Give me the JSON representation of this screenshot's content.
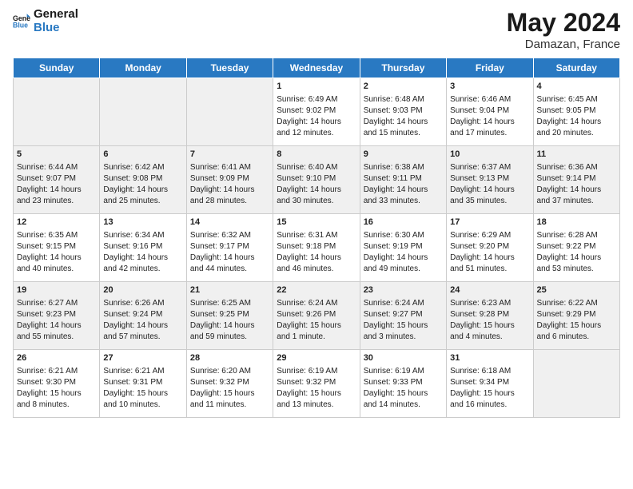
{
  "logo": {
    "line1": "General",
    "line2": "Blue"
  },
  "title": "May 2024",
  "location": "Damazan, France",
  "days_header": [
    "Sunday",
    "Monday",
    "Tuesday",
    "Wednesday",
    "Thursday",
    "Friday",
    "Saturday"
  ],
  "weeks": [
    [
      {
        "day": "",
        "content": ""
      },
      {
        "day": "",
        "content": ""
      },
      {
        "day": "",
        "content": ""
      },
      {
        "day": "1",
        "content": "Sunrise: 6:49 AM\nSunset: 9:02 PM\nDaylight: 14 hours\nand 12 minutes."
      },
      {
        "day": "2",
        "content": "Sunrise: 6:48 AM\nSunset: 9:03 PM\nDaylight: 14 hours\nand 15 minutes."
      },
      {
        "day": "3",
        "content": "Sunrise: 6:46 AM\nSunset: 9:04 PM\nDaylight: 14 hours\nand 17 minutes."
      },
      {
        "day": "4",
        "content": "Sunrise: 6:45 AM\nSunset: 9:05 PM\nDaylight: 14 hours\nand 20 minutes."
      }
    ],
    [
      {
        "day": "5",
        "content": "Sunrise: 6:44 AM\nSunset: 9:07 PM\nDaylight: 14 hours\nand 23 minutes."
      },
      {
        "day": "6",
        "content": "Sunrise: 6:42 AM\nSunset: 9:08 PM\nDaylight: 14 hours\nand 25 minutes."
      },
      {
        "day": "7",
        "content": "Sunrise: 6:41 AM\nSunset: 9:09 PM\nDaylight: 14 hours\nand 28 minutes."
      },
      {
        "day": "8",
        "content": "Sunrise: 6:40 AM\nSunset: 9:10 PM\nDaylight: 14 hours\nand 30 minutes."
      },
      {
        "day": "9",
        "content": "Sunrise: 6:38 AM\nSunset: 9:11 PM\nDaylight: 14 hours\nand 33 minutes."
      },
      {
        "day": "10",
        "content": "Sunrise: 6:37 AM\nSunset: 9:13 PM\nDaylight: 14 hours\nand 35 minutes."
      },
      {
        "day": "11",
        "content": "Sunrise: 6:36 AM\nSunset: 9:14 PM\nDaylight: 14 hours\nand 37 minutes."
      }
    ],
    [
      {
        "day": "12",
        "content": "Sunrise: 6:35 AM\nSunset: 9:15 PM\nDaylight: 14 hours\nand 40 minutes."
      },
      {
        "day": "13",
        "content": "Sunrise: 6:34 AM\nSunset: 9:16 PM\nDaylight: 14 hours\nand 42 minutes."
      },
      {
        "day": "14",
        "content": "Sunrise: 6:32 AM\nSunset: 9:17 PM\nDaylight: 14 hours\nand 44 minutes."
      },
      {
        "day": "15",
        "content": "Sunrise: 6:31 AM\nSunset: 9:18 PM\nDaylight: 14 hours\nand 46 minutes."
      },
      {
        "day": "16",
        "content": "Sunrise: 6:30 AM\nSunset: 9:19 PM\nDaylight: 14 hours\nand 49 minutes."
      },
      {
        "day": "17",
        "content": "Sunrise: 6:29 AM\nSunset: 9:20 PM\nDaylight: 14 hours\nand 51 minutes."
      },
      {
        "day": "18",
        "content": "Sunrise: 6:28 AM\nSunset: 9:22 PM\nDaylight: 14 hours\nand 53 minutes."
      }
    ],
    [
      {
        "day": "19",
        "content": "Sunrise: 6:27 AM\nSunset: 9:23 PM\nDaylight: 14 hours\nand 55 minutes."
      },
      {
        "day": "20",
        "content": "Sunrise: 6:26 AM\nSunset: 9:24 PM\nDaylight: 14 hours\nand 57 minutes."
      },
      {
        "day": "21",
        "content": "Sunrise: 6:25 AM\nSunset: 9:25 PM\nDaylight: 14 hours\nand 59 minutes."
      },
      {
        "day": "22",
        "content": "Sunrise: 6:24 AM\nSunset: 9:26 PM\nDaylight: 15 hours\nand 1 minute."
      },
      {
        "day": "23",
        "content": "Sunrise: 6:24 AM\nSunset: 9:27 PM\nDaylight: 15 hours\nand 3 minutes."
      },
      {
        "day": "24",
        "content": "Sunrise: 6:23 AM\nSunset: 9:28 PM\nDaylight: 15 hours\nand 4 minutes."
      },
      {
        "day": "25",
        "content": "Sunrise: 6:22 AM\nSunset: 9:29 PM\nDaylight: 15 hours\nand 6 minutes."
      }
    ],
    [
      {
        "day": "26",
        "content": "Sunrise: 6:21 AM\nSunset: 9:30 PM\nDaylight: 15 hours\nand 8 minutes."
      },
      {
        "day": "27",
        "content": "Sunrise: 6:21 AM\nSunset: 9:31 PM\nDaylight: 15 hours\nand 10 minutes."
      },
      {
        "day": "28",
        "content": "Sunrise: 6:20 AM\nSunset: 9:32 PM\nDaylight: 15 hours\nand 11 minutes."
      },
      {
        "day": "29",
        "content": "Sunrise: 6:19 AM\nSunset: 9:32 PM\nDaylight: 15 hours\nand 13 minutes."
      },
      {
        "day": "30",
        "content": "Sunrise: 6:19 AM\nSunset: 9:33 PM\nDaylight: 15 hours\nand 14 minutes."
      },
      {
        "day": "31",
        "content": "Sunrise: 6:18 AM\nSunset: 9:34 PM\nDaylight: 15 hours\nand 16 minutes."
      },
      {
        "day": "",
        "content": ""
      }
    ]
  ]
}
